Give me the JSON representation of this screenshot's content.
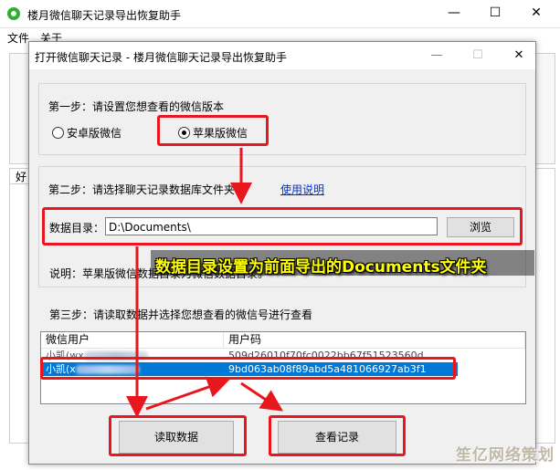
{
  "main_window": {
    "title": "楼月微信聊天记录导出恢复助手",
    "menu": [
      "文件",
      "关于"
    ],
    "list_header": "好",
    "controls": {
      "minimize": "—",
      "maximize": "☐",
      "close": "✕"
    }
  },
  "dialog": {
    "title": "打开微信聊天记录 - 楼月微信聊天记录导出恢复助手",
    "controls": {
      "minimize": "—",
      "maximize": "☐",
      "close": "✕"
    },
    "step1": {
      "label": "第一步：请设置您想查看的微信版本",
      "options": [
        {
          "label": "安卓版微信",
          "checked": false
        },
        {
          "label": "苹果版微信",
          "checked": true
        }
      ]
    },
    "step2": {
      "label": "第二步：请选择聊天记录数据库文件夹",
      "help_link": "使用说明",
      "dir_label": "数据目录：",
      "dir_value": "D:\\Documents\\",
      "browse_label": "浏览",
      "note": "说明：苹果版微信数据目录为微信数据目录。"
    },
    "step3": {
      "label": "第三步：请读取数据并选择您想查看的微信号进行查看",
      "columns": [
        "微信用户",
        "用户码"
      ],
      "rows": [
        {
          "user": "小凯(wx",
          "code": "509d26010f70fc0022bb67f51523560d",
          "selected": false
        },
        {
          "user": "小凯(x",
          "code": "9bd063ab08f89abd5a481066927ab3f1",
          "selected": true
        }
      ]
    },
    "read_button": "读取数据",
    "view_button": "查看记录"
  },
  "overlay_caption": "数据目录设置为前面导出的Documents文件夹",
  "watermark": "笙亿网络策划",
  "colors": {
    "highlight": "#e8161d",
    "caption": "#ffff00",
    "selection": "#0078d7",
    "link": "#0033cc"
  }
}
